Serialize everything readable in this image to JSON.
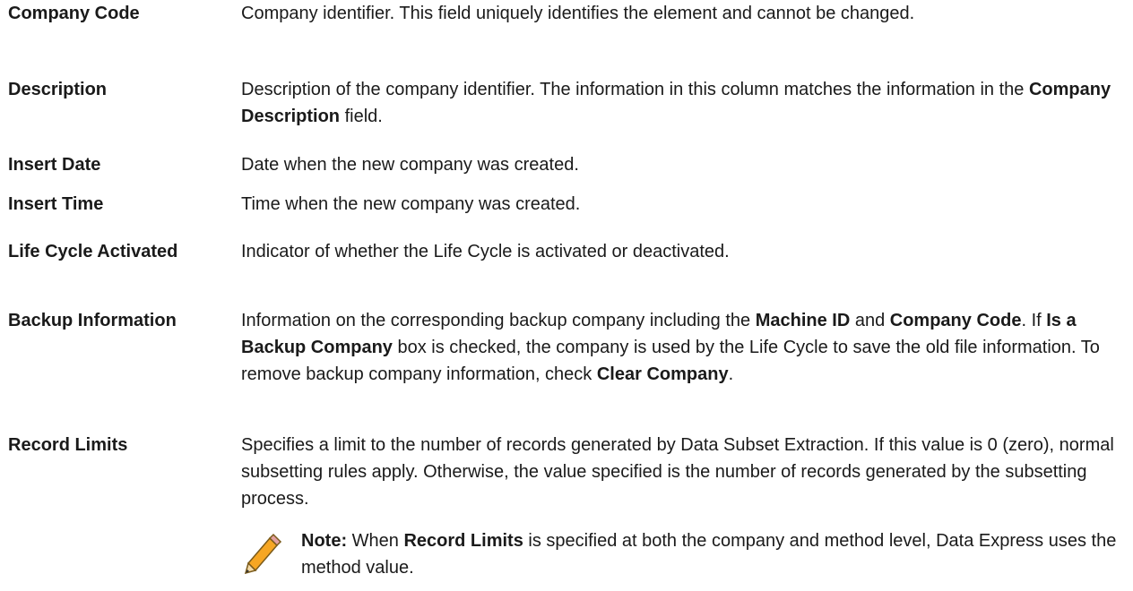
{
  "entries": [
    {
      "term": "Company Code",
      "def": [
        "Company identifier. This field uniquely identifies the element and cannot be changed."
      ]
    },
    {
      "term": "Description",
      "def": [
        "Description of the company identifier. The information in this column matches the information in the ",
        {
          "b": "Company Description"
        },
        " field."
      ]
    },
    {
      "term": "Insert Date",
      "def": [
        "Date when the new company was created."
      ]
    },
    {
      "term": "Insert Time",
      "def": [
        "Time when the new company was created."
      ]
    },
    {
      "term": "Life Cycle Activated",
      "def": [
        "Indicator of whether the Life Cycle is activated or deactivated."
      ]
    },
    {
      "term": "Backup Information",
      "def": [
        "Information on the corresponding backup company including the ",
        {
          "b": "Machine ID"
        },
        " and ",
        {
          "b": "Company Code"
        },
        ". If ",
        {
          "b": "Is a Backup Company"
        },
        " box is checked, the company is used by the Life Cycle to save the old file information. To remove backup company information, check ",
        {
          "b": "Clear Company"
        },
        "."
      ]
    },
    {
      "term": "Record Limits",
      "def": [
        "Specifies a limit to the number of records generated by Data Subset Extraction. If this value is 0 (zero), normal subsetting rules apply. Otherwise, the value specified is the number of records generated by the subsetting process."
      ]
    }
  ],
  "note": {
    "icon": "pencil-icon",
    "parts": [
      {
        "b": "Note:"
      },
      " When ",
      {
        "b": "Record Limits"
      },
      " is specified at both the company and method level, Data Express uses the method value."
    ]
  }
}
